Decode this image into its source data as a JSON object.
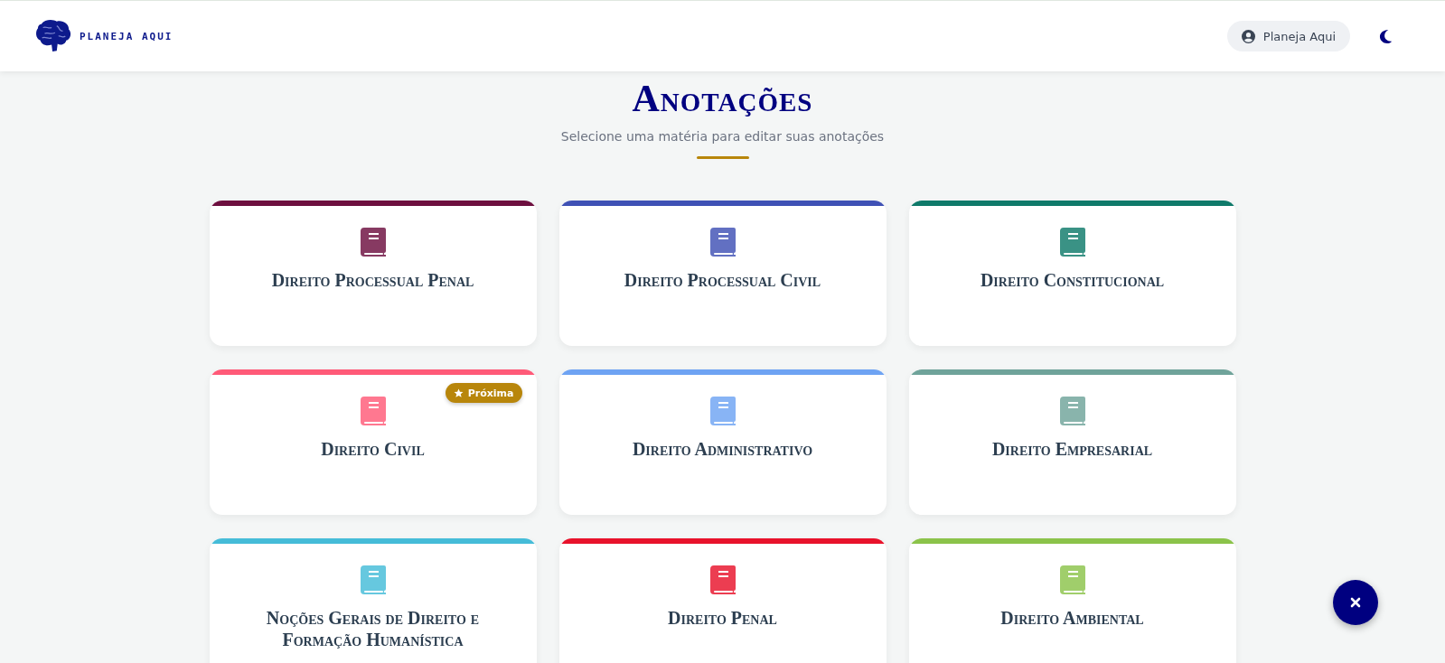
{
  "header": {
    "logo_text": "PLANEJA AQUI",
    "user_button": "Planeja Aqui"
  },
  "page": {
    "title": "Anotações",
    "subtitle": "Selecione uma matéria para editar suas anotações"
  },
  "subjects": [
    {
      "name": "Direito Processual Penal",
      "color": "#6d0f3f"
    },
    {
      "name": "Direito Processual Civil",
      "color": "#3f51b5"
    },
    {
      "name": "Direito Constitucional",
      "color": "#0f7a6a"
    },
    {
      "name": "Direito Civil",
      "color": "#ff5a78",
      "badge": "Próxima"
    },
    {
      "name": "Direito Administrativo",
      "color": "#6ea3f3"
    },
    {
      "name": "Direito Empresarial",
      "color": "#6fa39a"
    },
    {
      "name": "Noções Gerais de Direito e Formação Humanística",
      "color": "#45bcd8"
    },
    {
      "name": "Direito Penal",
      "color": "#e8122b"
    },
    {
      "name": "Direito Ambiental",
      "color": "#8bc34a"
    }
  ]
}
